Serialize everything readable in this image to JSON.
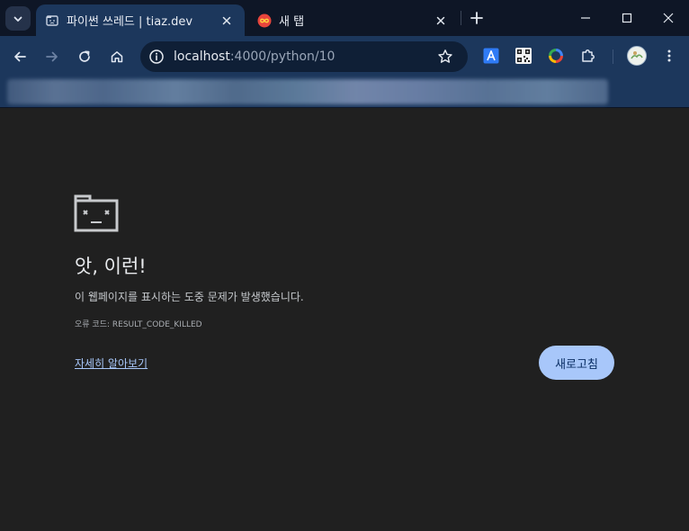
{
  "tabs": [
    {
      "title": "파이썬 쓰레드 | tiaz.dev",
      "active": true
    },
    {
      "title": "새 탭",
      "active": false
    }
  ],
  "address_bar": {
    "host": "localhost",
    "path": ":4000/python/10"
  },
  "error_page": {
    "title": "앗, 이런!",
    "description": "이 웹페이지를 표시하는 도중 문제가 발생했습니다.",
    "error_code_label": "오류 코드:",
    "error_code": "RESULT_CODE_KILLED",
    "learn_more": "자세히 알아보기",
    "reload_label": "새로고침"
  },
  "icons": {
    "tab_search": "chevron-down-icon",
    "back": "arrow-left-icon",
    "forward": "arrow-right-icon",
    "reload": "reload-icon",
    "home": "home-icon",
    "site_info": "info-icon",
    "bookmark": "star-icon",
    "extensions": [
      "translate-icon",
      "qr-code-icon",
      "color-ring-icon",
      "puzzle-icon"
    ],
    "profile": "avatar",
    "menu": "kebab-menu-icon"
  },
  "colors": {
    "tab_strip": "#0e1626",
    "toolbar": "#1c375c",
    "page_background": "#202020",
    "accent_button": "#a8c7fa",
    "link": "#a8c7fa"
  }
}
